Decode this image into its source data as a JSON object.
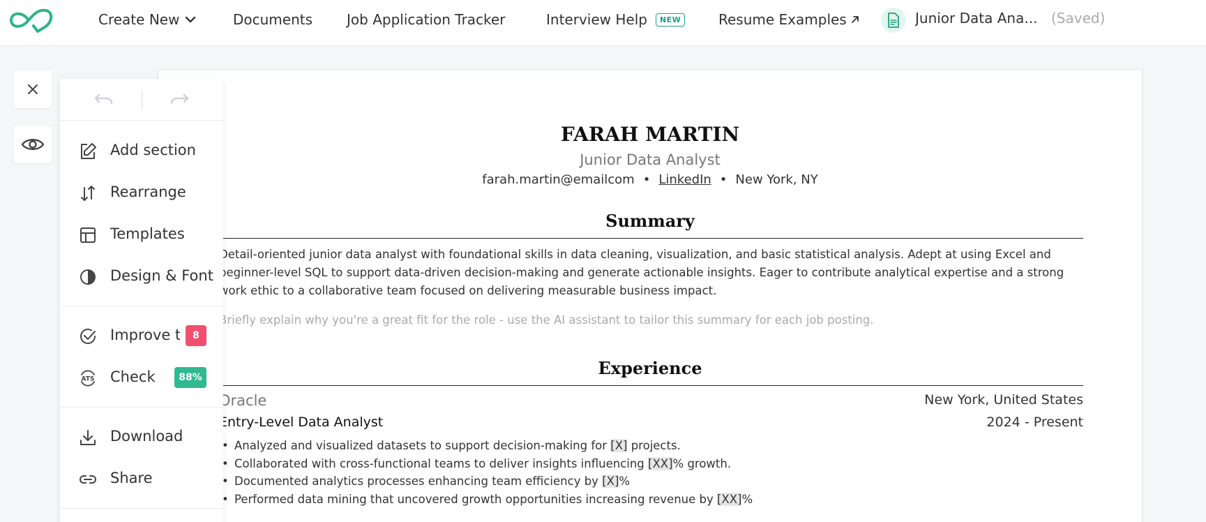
{
  "nav": {
    "create_new": "Create New",
    "documents": "Documents",
    "job_tracker": "Job Application Tracker",
    "interview_help": "Interview Help",
    "new_badge": "NEW",
    "resume_examples": "Resume Examples",
    "doc_title": "Junior Data Ana...",
    "saved": "(Saved)"
  },
  "menu": {
    "add_section": "Add section",
    "rearrange": "Rearrange",
    "templates": "Templates",
    "design_font": "Design & Font",
    "improve_text": "Improve te",
    "improve_count": "8",
    "check": "Check",
    "ats_label": "ATS",
    "ats_score": "88%",
    "download": "Download",
    "share": "Share"
  },
  "resume": {
    "name": "FARAH MARTIN",
    "role": "Junior Data Analyst",
    "email": "farah.martin@emailcom",
    "linkedin": "LinkedIn",
    "location": "New York, NY",
    "summary_title": "Summary",
    "summary": "Detail-oriented junior data analyst with foundational skills in data cleaning, visualization, and basic statistical analysis. Adept at using Excel and beginner-level SQL to support data-driven decision-making and generate actionable insights. Eager to contribute analytical expertise and a strong work ethic to a collaborative team focused on delivering measurable business impact.",
    "summary_hint": "Briefly explain why you're a great fit for the role - use the AI assistant to tailor this summary for each job posting.",
    "experience_title": "Experience",
    "company": "Oracle",
    "company_location": "New York, United States",
    "job_title": "Entry-Level Data Analyst",
    "dates": "2024 - Present",
    "bullets": [
      {
        "pre": "Analyzed and visualized datasets to support decision-making for ",
        "ph": "[X]",
        "post": " projects."
      },
      {
        "pre": "Collaborated with cross-functional teams to deliver insights influencing ",
        "ph": "[XX]",
        "post": "% growth."
      },
      {
        "pre": "Documented analytics processes enhancing team efficiency by ",
        "ph": "[X]",
        "post": "%"
      },
      {
        "pre": "Performed data mining that uncovered growth opportunities increasing revenue by ",
        "ph": "[XX]",
        "post": "%"
      }
    ]
  },
  "colors": {
    "accent_green": "#21a07f",
    "badge_red": "#f0506e",
    "badge_green": "#2fb98f"
  }
}
